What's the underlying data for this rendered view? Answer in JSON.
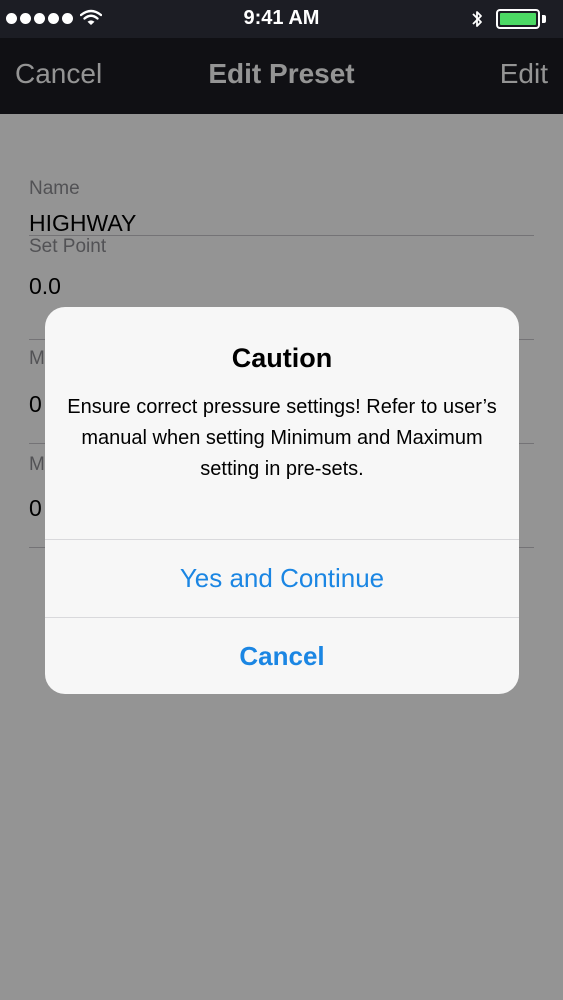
{
  "status_bar": {
    "time": "9:41 AM",
    "signal_dots": 5,
    "battery_level": 1.0,
    "colors": {
      "bar_bg": "#1c1d24",
      "battery_fill": "#4cd964"
    }
  },
  "nav": {
    "left_label": "Cancel",
    "title": "Edit Preset",
    "right_label": "Edit"
  },
  "form": {
    "fields": [
      {
        "label": "Name",
        "value": "HIGHWAY"
      },
      {
        "label": "Set Point",
        "value": "0.0"
      },
      {
        "label": "M",
        "value": "0"
      },
      {
        "label": "M",
        "value": "0"
      }
    ]
  },
  "alert": {
    "title": "Caution",
    "message": "Ensure correct pressure settings! Refer to user’s manual when setting Minimum and Maximum setting in pre-sets.",
    "primary_button": "Yes and Continue",
    "cancel_button": "Cancel",
    "accent_color": "#1b86e3"
  },
  "icons": {
    "wifi": "wifi-icon",
    "bluetooth": "bluetooth-icon",
    "battery": "battery-icon"
  }
}
